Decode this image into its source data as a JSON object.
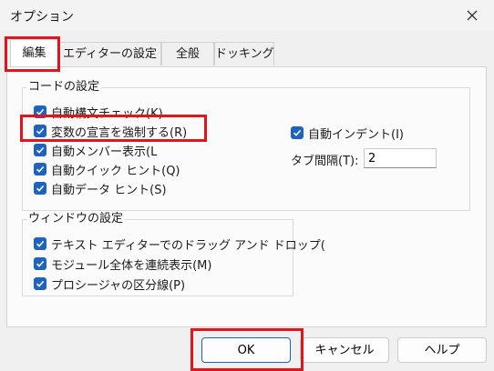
{
  "window": {
    "title": "オプション"
  },
  "tabs": [
    {
      "label": "編集",
      "active": true
    },
    {
      "label": "エディターの設定",
      "active": false
    },
    {
      "label": "全般",
      "active": false
    },
    {
      "label": "ドッキング",
      "active": false
    }
  ],
  "code_settings": {
    "group_label": "コードの設定",
    "options": [
      {
        "label": "自動構文チェック(K)",
        "checked": true
      },
      {
        "label": "変数の宣言を強制する(R)",
        "checked": true
      },
      {
        "label": "自動メンバー表示(L",
        "checked": true
      },
      {
        "label": "自動クイック ヒント(Q)",
        "checked": true
      },
      {
        "label": "自動データ ヒント(S)",
        "checked": true
      }
    ],
    "auto_indent": {
      "label": "自動インデント(I)",
      "checked": true
    },
    "tab_interval": {
      "label": "タブ間隔(T):",
      "value": "2"
    }
  },
  "window_settings": {
    "group_label": "ウィンドウの設定",
    "options": [
      {
        "label": "テキスト エディターでのドラッグ アンド ドロップ(",
        "checked": true
      },
      {
        "label": "モジュール全体を連続表示(M)",
        "checked": true
      },
      {
        "label": "プロシージャの区分線(P)",
        "checked": true
      }
    ]
  },
  "buttons": {
    "ok": "OK",
    "cancel": "キャンセル",
    "help": "ヘルプ"
  },
  "colors": {
    "accent": "#1f63c2",
    "highlight": "#e3141b"
  }
}
